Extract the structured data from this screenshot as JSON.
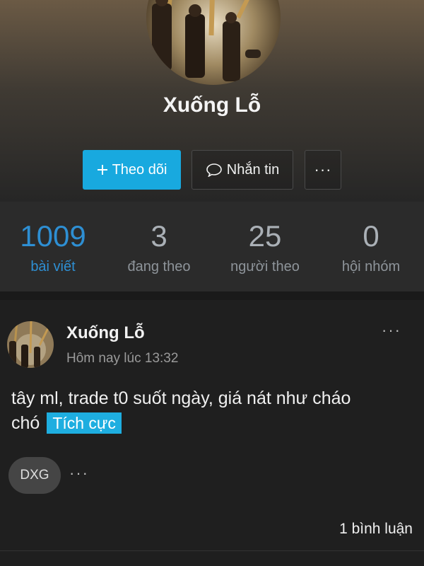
{
  "profile": {
    "name": "Xuống Lỗ",
    "follow_label": "Theo dõi",
    "follow_icon": "plus-icon",
    "message_label": "Nhắn tin",
    "message_icon": "chat-bubble-icon",
    "more_label": "···"
  },
  "stats": [
    {
      "value": "1009",
      "label": "bài viết"
    },
    {
      "value": "3",
      "label": "đang theo"
    },
    {
      "value": "25",
      "label": "người theo"
    },
    {
      "value": "0",
      "label": "hội nhóm"
    }
  ],
  "post": {
    "author": "Xuống Lỗ",
    "time": "Hôm nay lúc 13:32",
    "menu": "···",
    "text": "tây ml, trade t0 suốt ngày, giá nát như cháo chó",
    "sentiment": "Tích cực",
    "tag": "DXG",
    "tag_more": "···",
    "comments": "1 bình luận"
  },
  "colors": {
    "accent": "#18a9df",
    "active_stat": "#2e8fd3",
    "background": "#1f1f1f"
  }
}
